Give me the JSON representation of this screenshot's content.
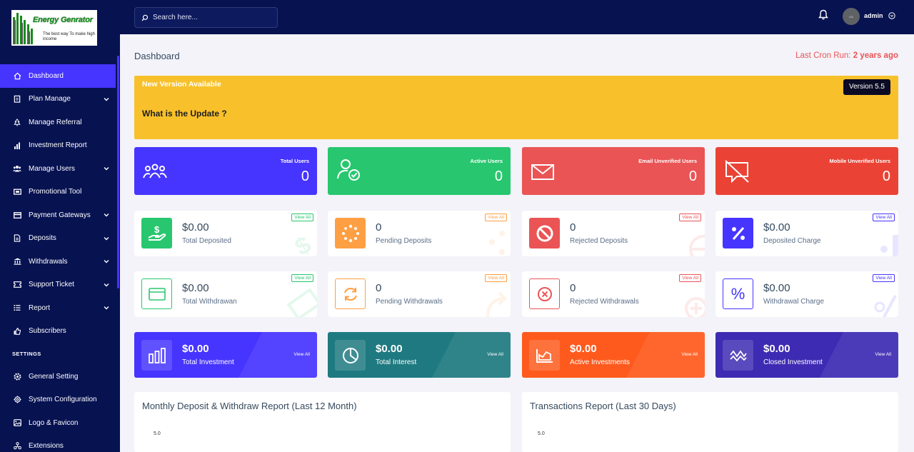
{
  "app": {
    "logo_title": "Energy Genrator",
    "logo_tagline": "The best way To make high income"
  },
  "sidebar": {
    "items": [
      {
        "label": "Dashboard",
        "icon": "home-icon",
        "active": true,
        "has_chevron": false
      },
      {
        "label": "Plan Manage",
        "icon": "clipboard-icon",
        "active": false,
        "has_chevron": true
      },
      {
        "label": "Manage Referral",
        "icon": "tree-icon",
        "active": false,
        "has_chevron": false
      },
      {
        "label": "Investment Report",
        "icon": "bar-chart-icon",
        "active": false,
        "has_chevron": false
      },
      {
        "label": "Manage Users",
        "icon": "users-icon",
        "active": false,
        "has_chevron": true
      },
      {
        "label": "Promotional Tool",
        "icon": "tv-icon",
        "active": false,
        "has_chevron": false
      },
      {
        "label": "Payment Gateways",
        "icon": "credit-card-icon",
        "active": false,
        "has_chevron": true
      },
      {
        "label": "Deposits",
        "icon": "deposit-icon",
        "active": false,
        "has_chevron": true
      },
      {
        "label": "Withdrawals",
        "icon": "bank-icon",
        "active": false,
        "has_chevron": true
      },
      {
        "label": "Support Ticket",
        "icon": "ticket-icon",
        "active": false,
        "has_chevron": true
      },
      {
        "label": "Report",
        "icon": "list-icon",
        "active": false,
        "has_chevron": true
      },
      {
        "label": "Subscribers",
        "icon": "thumbs-up-icon",
        "active": false,
        "has_chevron": false
      }
    ],
    "settings_title": "SETTINGS",
    "settings_items": [
      {
        "label": "General Setting",
        "icon": "cog-icon"
      },
      {
        "label": "System Configuration",
        "icon": "cogs-icon"
      },
      {
        "label": "Logo & Favicon",
        "icon": "images-icon"
      },
      {
        "label": "Extensions",
        "icon": "puzzle-icon"
      }
    ]
  },
  "topbar": {
    "search_placeholder": "Search here...",
    "avatar_text": "OA",
    "username": "admin"
  },
  "main": {
    "page_title": "Dashboard",
    "cron_label": "Last Cron Run:",
    "cron_value": "2 years ago",
    "update": {
      "heading": "New Version Available",
      "question": "What is the Update ?",
      "version_button": "Version 5.5"
    },
    "stats": [
      {
        "label": "Total Users",
        "value": "0",
        "color": "#4634ff"
      },
      {
        "label": "Active Users",
        "value": "0",
        "color": "#28c76f"
      },
      {
        "label": "Email Unverified Users",
        "value": "0",
        "color": "#ea5455"
      },
      {
        "label": "Mobile Unverified Users",
        "value": "0",
        "color": "#ea4335"
      }
    ],
    "widgets_row1": [
      {
        "value": "$0.00",
        "label": "Total Deposited",
        "view_all": "View All",
        "accent": "#28c76f"
      },
      {
        "value": "0",
        "label": "Pending Deposits",
        "view_all": "View All",
        "accent": "#ff9f43"
      },
      {
        "value": "0",
        "label": "Rejected Deposits",
        "view_all": "View All",
        "accent": "#ea5455"
      },
      {
        "value": "$0.00",
        "label": "Deposited Charge",
        "view_all": "View All",
        "accent": "#4634ff"
      }
    ],
    "widgets_row2": [
      {
        "value": "$0.00",
        "label": "Total Withdrawan",
        "view_all": "View All",
        "accent": "#28c76f"
      },
      {
        "value": "0",
        "label": "Pending Withdrawals",
        "view_all": "View All",
        "accent": "#ff9f43"
      },
      {
        "value": "0",
        "label": "Rejected Withdrawals",
        "view_all": "View All",
        "accent": "#ea5455"
      },
      {
        "value": "$0.00",
        "label": "Withdrawal Charge",
        "view_all": "View All",
        "accent": "#4634ff"
      }
    ],
    "summary": [
      {
        "value": "$0.00",
        "label": "Total Investment",
        "view_all": "View All",
        "color": "#4634ff"
      },
      {
        "value": "$0.00",
        "label": "Total Interest",
        "view_all": "View All",
        "color": "#1e7a80"
      },
      {
        "value": "$0.00",
        "label": "Active Investments",
        "view_all": "View All",
        "color": "#fe5a1d"
      },
      {
        "value": "$0.00",
        "label": "Closed Investment",
        "view_all": "View All",
        "color": "#3d2bb3"
      }
    ],
    "charts": [
      {
        "title": "Monthly Deposit & Withdraw Report (Last 12 Month)",
        "tick": "5.0"
      },
      {
        "title": "Transactions Report (Last 30 Days)",
        "tick": "5.0"
      }
    ]
  }
}
